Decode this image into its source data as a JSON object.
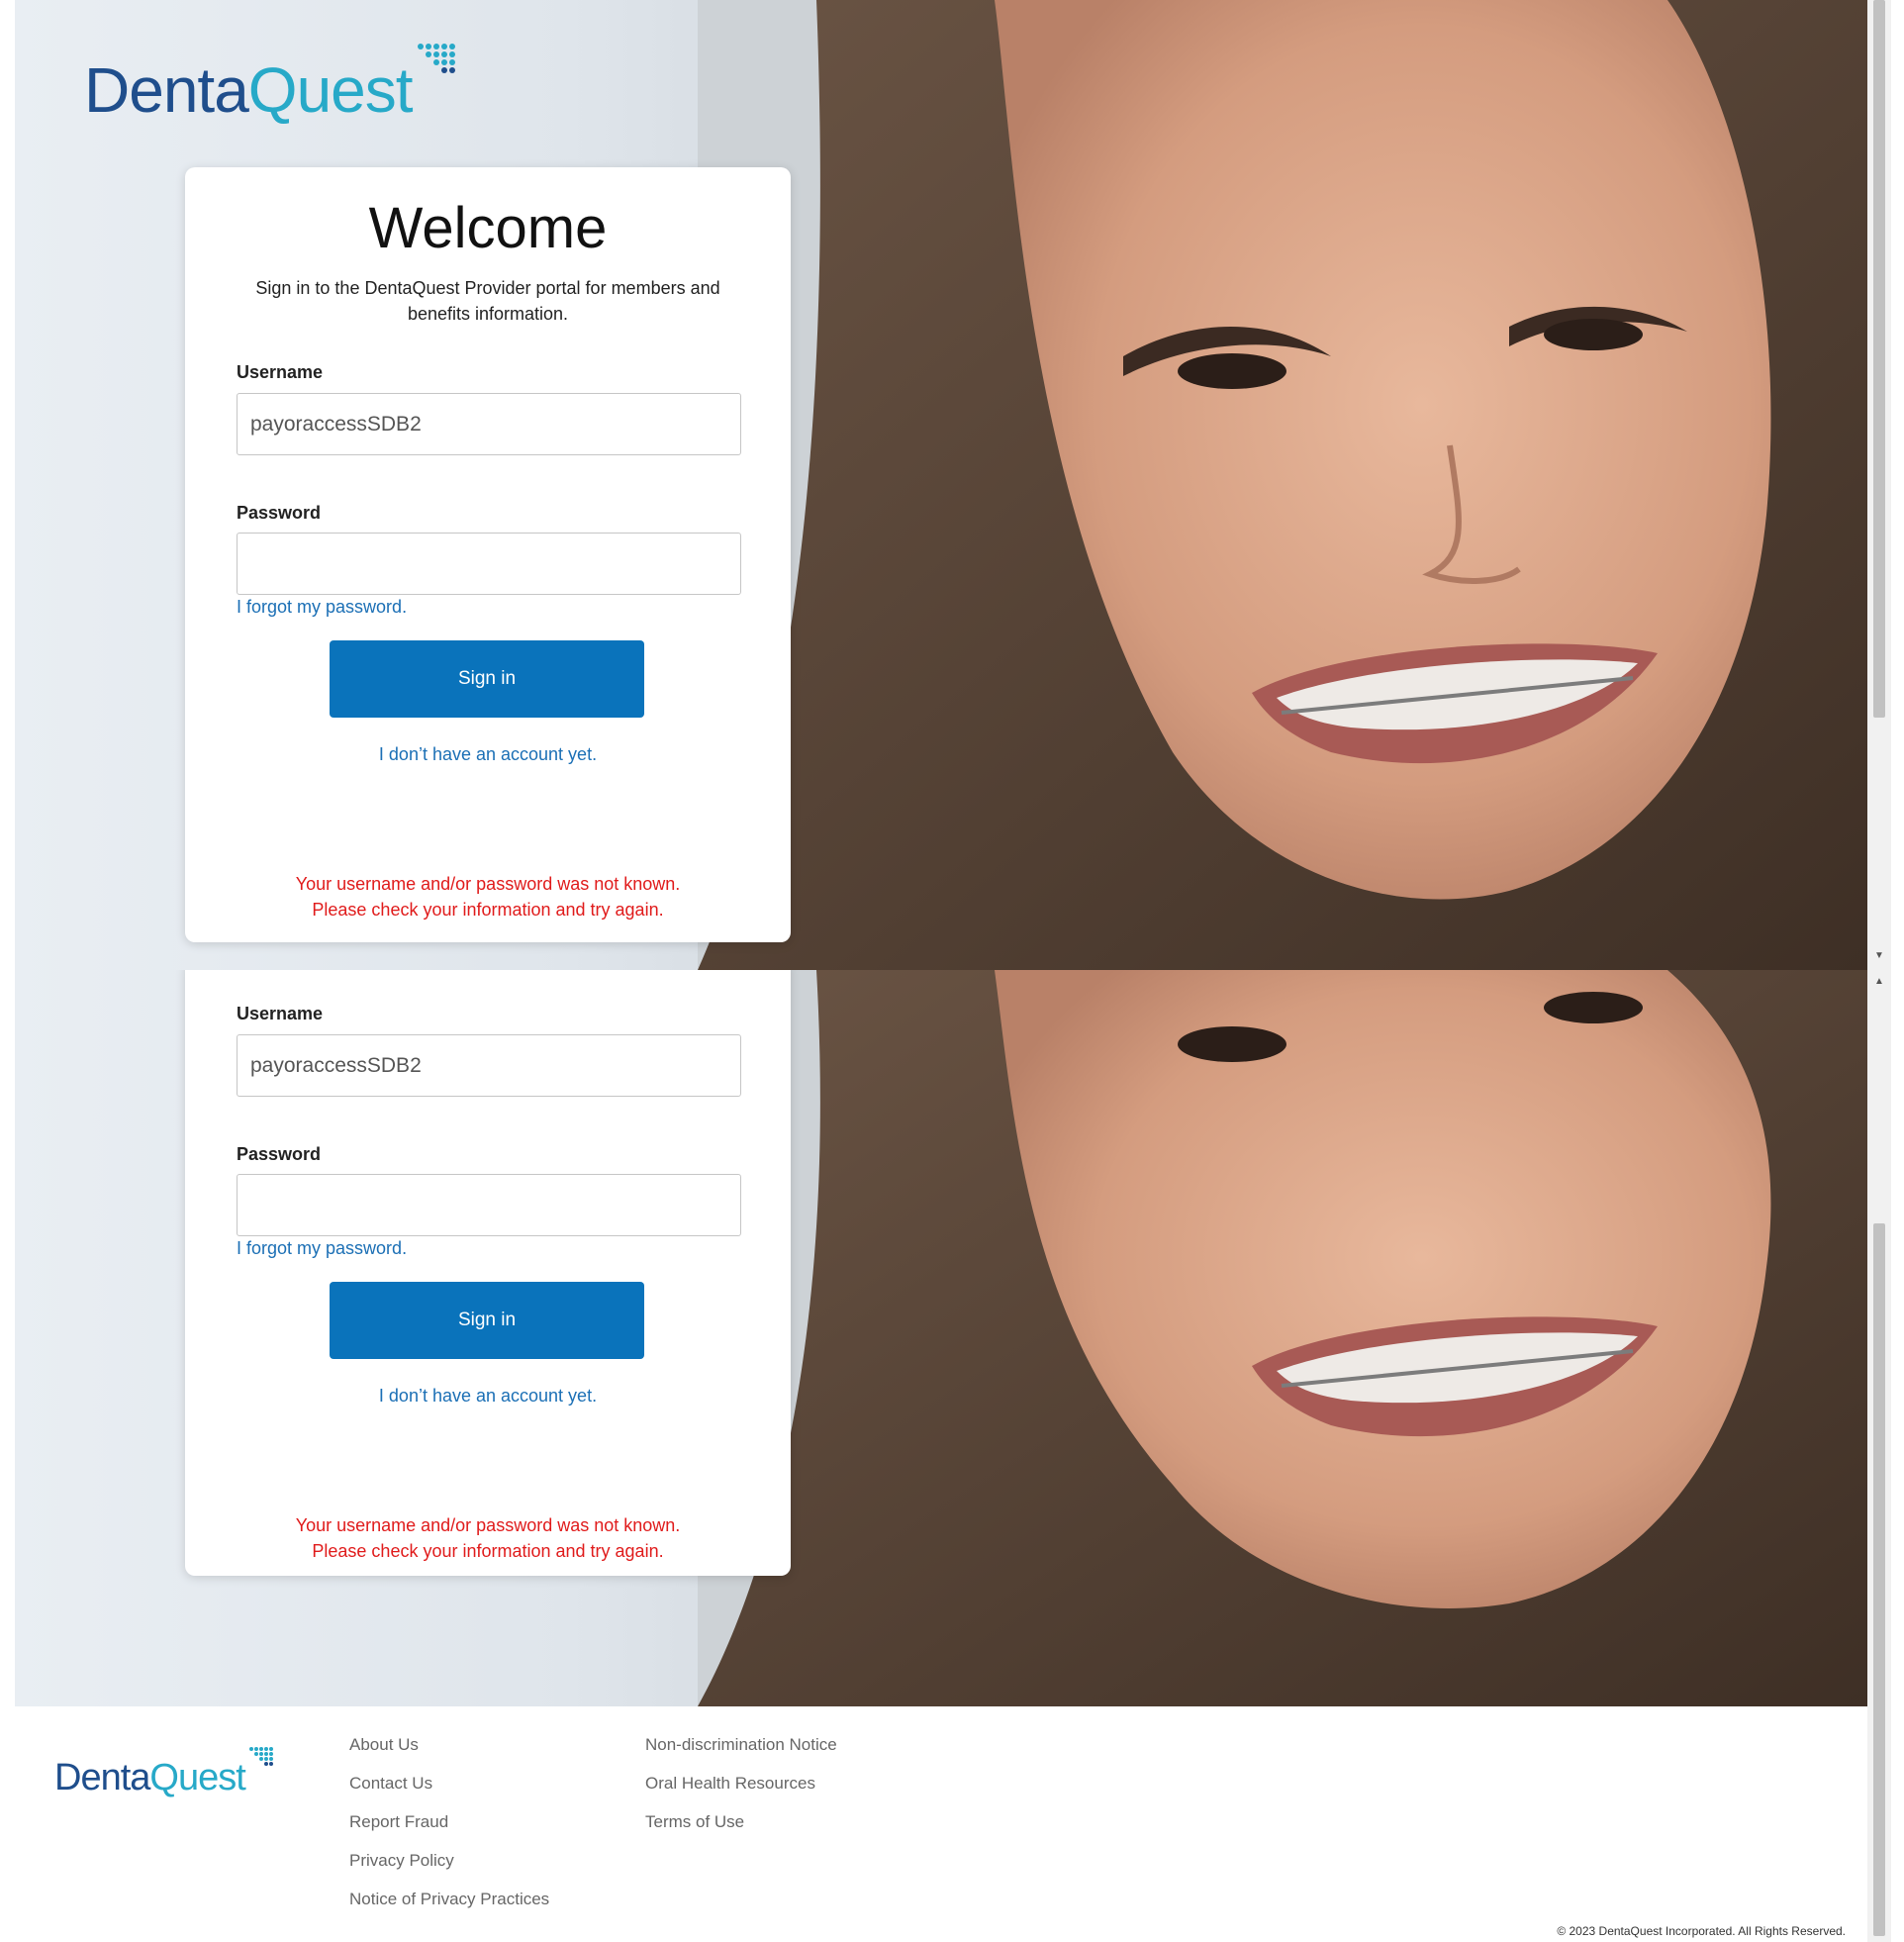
{
  "brand": {
    "name_part1": "Denta",
    "name_part2": "Quest",
    "registered": "®"
  },
  "login": {
    "heading": "Welcome",
    "intro": "Sign in to the DentaQuest Provider portal for members and benefits information.",
    "username_label": "Username",
    "username_value": "payoraccessSDB2",
    "password_label": "Password",
    "forgot_link": "I forgot my password.",
    "signin_button": "Sign in",
    "no_account_link": "I don’t have an account yet.",
    "error_line1": "Your username and/or password was not known.",
    "error_line2": "Please check your information and try again."
  },
  "footer": {
    "col1": [
      "About Us",
      "Contact Us",
      "Report Fraud",
      "Privacy Policy",
      "Notice of Privacy Practices"
    ],
    "col2": [
      "Non-discrimination Notice",
      "Oral Health Resources",
      "Terms of Use"
    ],
    "copyright": "© 2023 DentaQuest Incorporated. All Rights Reserved."
  },
  "colors": {
    "primary_button": "#0a73bb",
    "link": "#1b6fb5",
    "error": "#e01b1b",
    "brand_dark": "#1f4e8c",
    "brand_light": "#27a9c8"
  },
  "icons": [
    "dentaquest-dots-logo-icon",
    "scroll-up-arrow-icon",
    "scroll-down-arrow-icon"
  ]
}
